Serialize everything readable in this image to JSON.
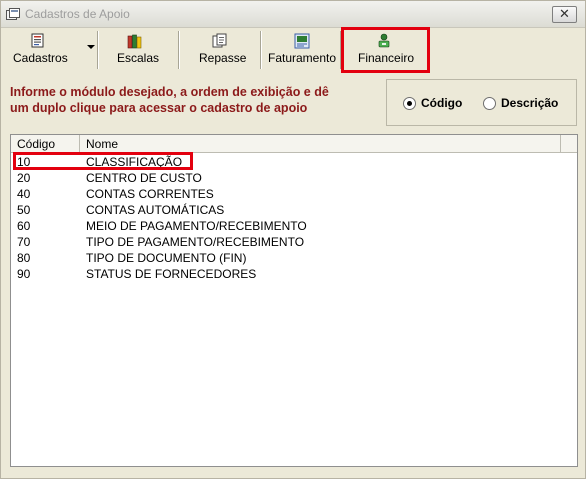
{
  "window": {
    "title": "Cadastros de Apoio",
    "close_label": "✕"
  },
  "toolbar": {
    "buttons": [
      {
        "label": "Cadastros",
        "icon": "form-icon"
      },
      {
        "label": "Escalas",
        "icon": "books-icon"
      },
      {
        "label": "Repasse",
        "icon": "documents-icon"
      },
      {
        "label": "Faturamento",
        "icon": "report-icon"
      },
      {
        "label": "Financeiro",
        "icon": "money-icon"
      }
    ]
  },
  "info": {
    "line1": "Informe o módulo desejado, a ordem de exibição e dê",
    "line2": "um duplo clique para acessar o cadastro de apoio"
  },
  "order": {
    "options": [
      {
        "label": "Código",
        "checked": true
      },
      {
        "label": "Descrição",
        "checked": false
      }
    ]
  },
  "list": {
    "columns": [
      "Código",
      "Nome"
    ],
    "rows": [
      {
        "code": "10",
        "name": "CLASSIFICAÇÃO"
      },
      {
        "code": "20",
        "name": "CENTRO DE CUSTO"
      },
      {
        "code": "40",
        "name": "CONTAS CORRENTES"
      },
      {
        "code": "50",
        "name": "CONTAS AUTOMÁTICAS"
      },
      {
        "code": "60",
        "name": "MEIO DE PAGAMENTO/RECEBIMENTO"
      },
      {
        "code": "70",
        "name": "TIPO DE PAGAMENTO/RECEBIMENTO"
      },
      {
        "code": "80",
        "name": "TIPO DE DOCUMENTO (FIN)"
      },
      {
        "code": "90",
        "name": "STATUS DE FORNECEDORES"
      }
    ]
  },
  "colors": {
    "highlight": "#e3000f",
    "info_text": "#8c1a1a"
  }
}
